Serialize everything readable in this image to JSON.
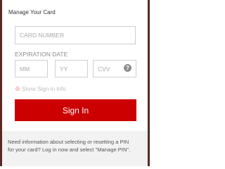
{
  "colors": {
    "accent": "#cc0000",
    "backdrop": "#5a2a22",
    "footer_bg": "#f2f2f2"
  },
  "dialog": {
    "title": "Manage Your Card"
  },
  "form": {
    "card_number": {
      "value": "",
      "placeholder": "CARD NUMBER"
    },
    "expiration_label": "EXPIRATION DATE",
    "month": {
      "value": "",
      "placeholder": "MM"
    },
    "year": {
      "value": "",
      "placeholder": "YY"
    },
    "cvv": {
      "value": "",
      "placeholder": "CVV",
      "help_icon": "question-icon",
      "help_symbol": "?"
    },
    "show_signin_info": {
      "label": "Show Sign-in Info",
      "selected": false
    },
    "submit_label": "Sign In"
  },
  "footer": {
    "line1": "Need information about selecting or resetting a PIN",
    "line2": "for your card? Log in now and select \"Manage PIN\"."
  }
}
